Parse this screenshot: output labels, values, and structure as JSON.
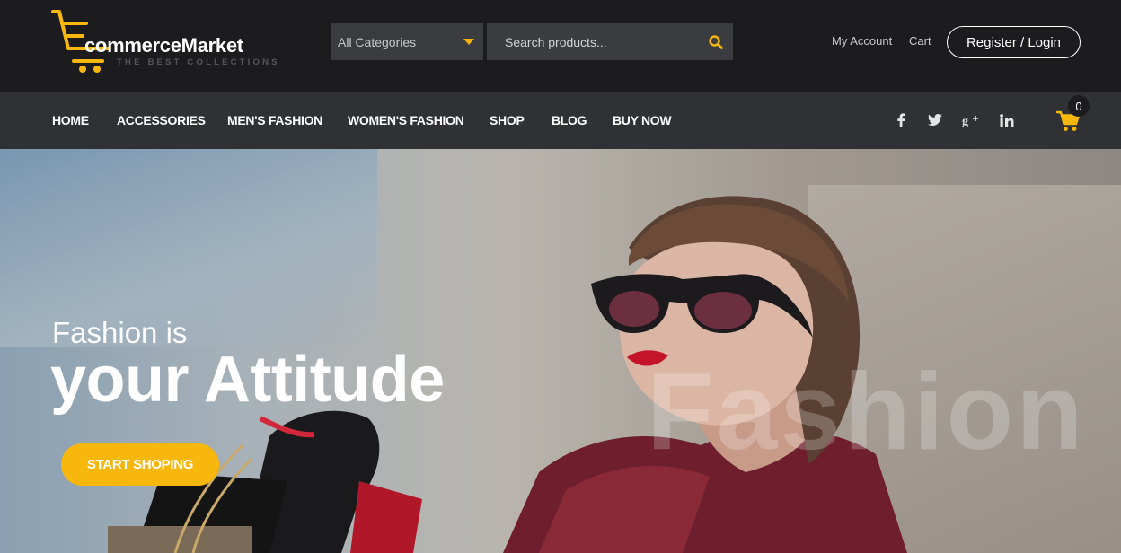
{
  "header": {
    "logo": {
      "name": "commerceMarket",
      "tagline": "THE BEST COLLECTIONS"
    },
    "category_select": {
      "selected": "All Categories"
    },
    "search": {
      "placeholder": "Search products..."
    },
    "links": {
      "my_account": "My Account",
      "cart": "Cart"
    },
    "register_login": "Register / Login"
  },
  "nav": {
    "items": [
      "HOME",
      "ACCESSORIES",
      "MEN'S FASHION",
      "WOMEN'S FASHION",
      "SHOP",
      "BLOG",
      "BUY NOW"
    ],
    "social_icons": [
      "facebook-icon",
      "twitter-icon",
      "google-plus-icon",
      "linkedin-icon"
    ],
    "cart_count": "0"
  },
  "hero": {
    "line1": "Fashion is",
    "line2": "your Attitude",
    "watermark": "Fashion",
    "cta": "START SHOPING"
  },
  "colors": {
    "accent": "#f7b70d",
    "header_bg": "#1c1c1e",
    "nav_bg": "#303135",
    "input_bg": "#3b3c40"
  }
}
